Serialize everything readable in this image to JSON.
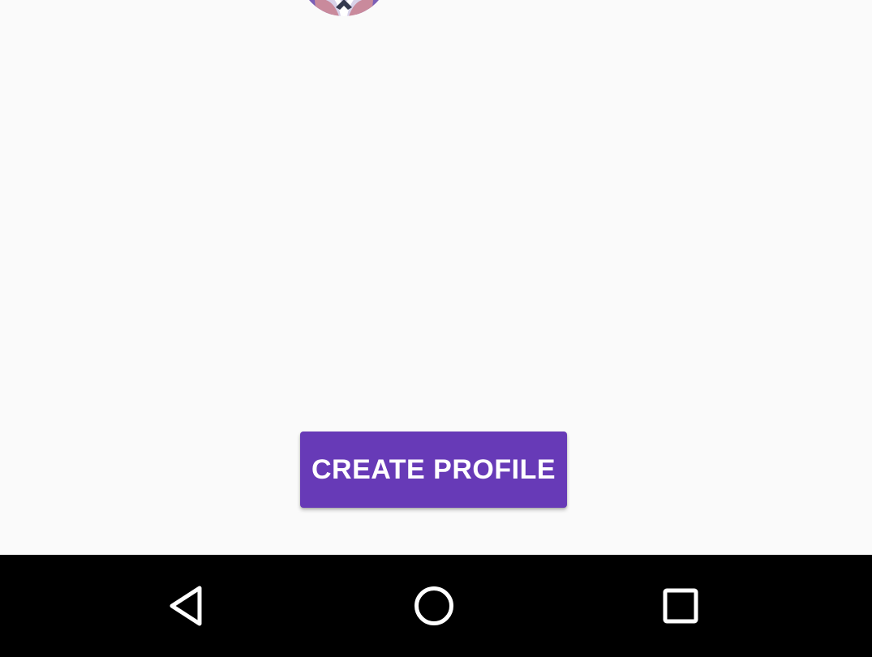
{
  "main": {
    "avatar_icon": "profile-avatar-image",
    "create_profile_label": "CREATE PROFILE",
    "colors": {
      "background": "#fafafa",
      "primary_button": "#673ab7",
      "button_text": "#ffffff",
      "navigation_bar": "#000000",
      "navigation_icons": "#ffffff"
    }
  },
  "navigation": {
    "back_icon": "back-triangle-icon",
    "home_icon": "home-circle-icon",
    "recents_icon": "recents-square-icon"
  }
}
